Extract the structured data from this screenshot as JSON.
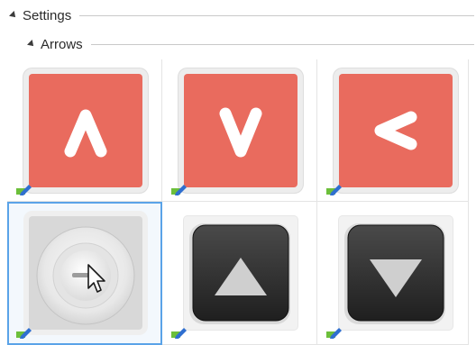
{
  "sections": {
    "settings": {
      "label": "Settings",
      "expanded": true
    },
    "arrows": {
      "label": "Arrows",
      "expanded": true
    }
  },
  "icons": [
    {
      "name": "arrow-up-red-icon",
      "style": "red",
      "glyph": "caret-up"
    },
    {
      "name": "arrow-down-red-icon",
      "style": "red",
      "glyph": "caret-down"
    },
    {
      "name": "arrow-left-red-icon",
      "style": "red",
      "glyph": "caret-left"
    },
    {
      "name": "round-knob-button-icon",
      "style": "grey",
      "glyph": "knob",
      "selected": true
    },
    {
      "name": "arrow-up-dark-icon",
      "style": "dark",
      "glyph": "triangle-up"
    },
    {
      "name": "arrow-down-dark-icon",
      "style": "dark",
      "glyph": "triangle-down"
    }
  ],
  "colors": {
    "red_tile": "#e96b5e",
    "dark_tile": "#2b2b2b",
    "selection": "#5aa3e8",
    "badge_green": "#6cbf3a",
    "badge_blue": "#2f6fd0"
  }
}
